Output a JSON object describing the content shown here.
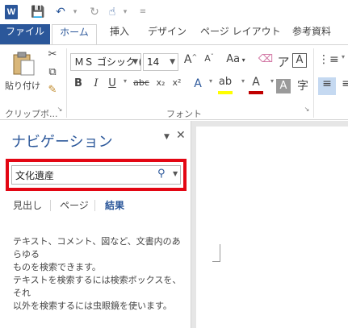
{
  "app": {
    "logo": "W"
  },
  "qat": {
    "icons": [
      "save-icon",
      "undo-icon",
      "redo-icon",
      "touch-mode-icon",
      "customize-icon"
    ]
  },
  "tabs": [
    "ファイル",
    "ホーム",
    "挿入",
    "デザイン",
    "ページ レイアウト",
    "参考資料"
  ],
  "active_tab": "ホーム",
  "ribbon": {
    "clipboard": {
      "paste_label": "貼り付け",
      "group_label": "クリップボ..."
    },
    "font": {
      "font_name": "ＭＳ ゴシック (...",
      "font_size": "14",
      "grow": "A",
      "shrink": "A",
      "case": "Aa",
      "bold": "B",
      "italic": "I",
      "underline": "U",
      "strike": "abc",
      "subscript": "x₂",
      "superscript": "x²",
      "group_label": "フォント"
    }
  },
  "nav_pane": {
    "title": "ナビゲーション",
    "search": {
      "value": "文化遺産",
      "placeholder": ""
    },
    "subtabs": [
      "見出し",
      "ページ",
      "結果"
    ],
    "active_subtab": "結果",
    "message1_line1": "テキスト、コメント、図など、文書内のあらゆる",
    "message1_line2": "ものを検索できます。",
    "message2_line1": "テキストを検索するには検索ボックスを、それ",
    "message2_line2": "以外を検索するには虫眼鏡を使います。"
  },
  "colors": {
    "accent": "#2b579a",
    "highlight_box": "#e30613",
    "font_color": "#c00000",
    "highlight_color": "#ffff00"
  }
}
